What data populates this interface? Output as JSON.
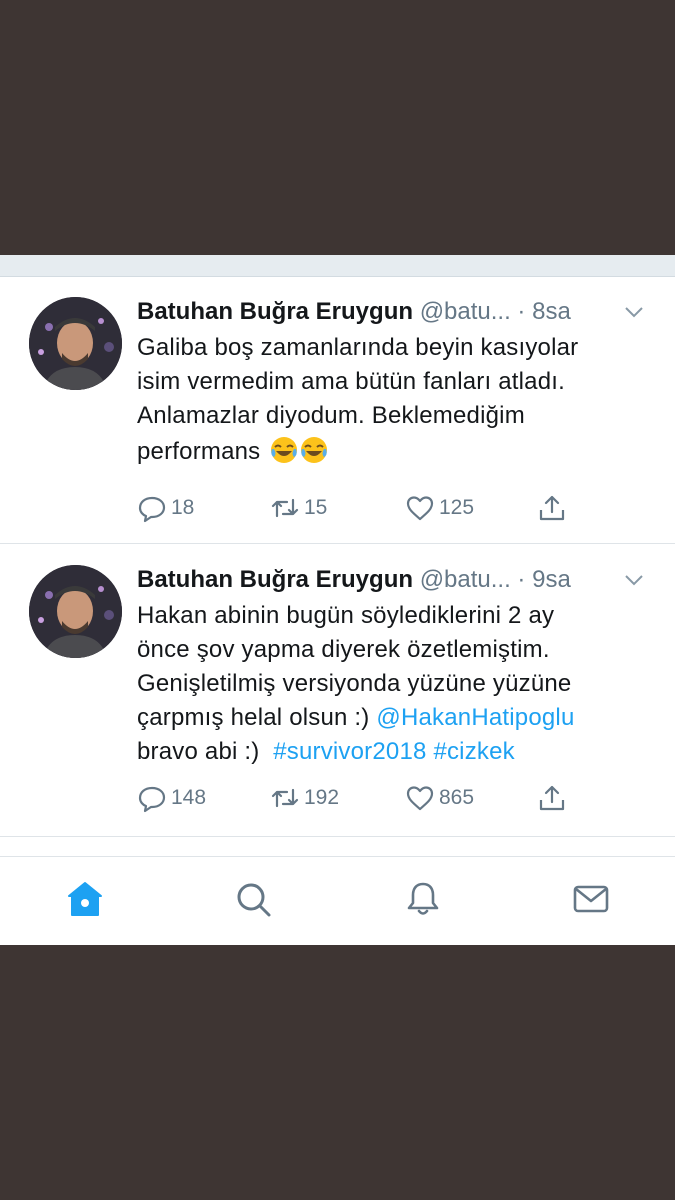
{
  "colors": {
    "background_dark": "#3e3533",
    "accent": "#1da1f2",
    "text_primary": "#14171a",
    "text_secondary": "#657786"
  },
  "tweets": [
    {
      "author_name": "Batuhan Buğra Eruygun",
      "handle": "@batu...",
      "separator": " · ",
      "time": "8sa",
      "lines": [
        "Galiba boş zamanlarında beyin kasıyolar",
        "isim vermedim ama bütün fanları atladı.",
        "Anlamazlar diyodum. Beklemediğim",
        "performans"
      ],
      "emoji": [
        "face-with-tears-of-joy",
        "face-with-tears-of-joy"
      ],
      "replies": "18",
      "retweets": "15",
      "likes": "125"
    },
    {
      "author_name": "Batuhan Buğra Eruygun",
      "handle": "@batu...",
      "separator": " · ",
      "time": "9sa",
      "lines": [
        "Hakan abinin bugün söylediklerini 2 ay",
        "önce şov yapma diyerek özetlemiştim.",
        "Genişletilmiş versiyonda yüzüne yüzüne",
        "çarpmış helal olsun :) "
      ],
      "mention": "@HakanHatipoglu",
      "last_line_text": "bravo abi :)  ",
      "hashtags": [
        "#survivor2018",
        "#cizkek"
      ],
      "replies": "148",
      "retweets": "192",
      "likes": "865"
    }
  ],
  "tabbar": {
    "items": [
      "home-icon",
      "search-icon",
      "notifications-icon",
      "messages-icon"
    ],
    "active": "home-icon"
  }
}
